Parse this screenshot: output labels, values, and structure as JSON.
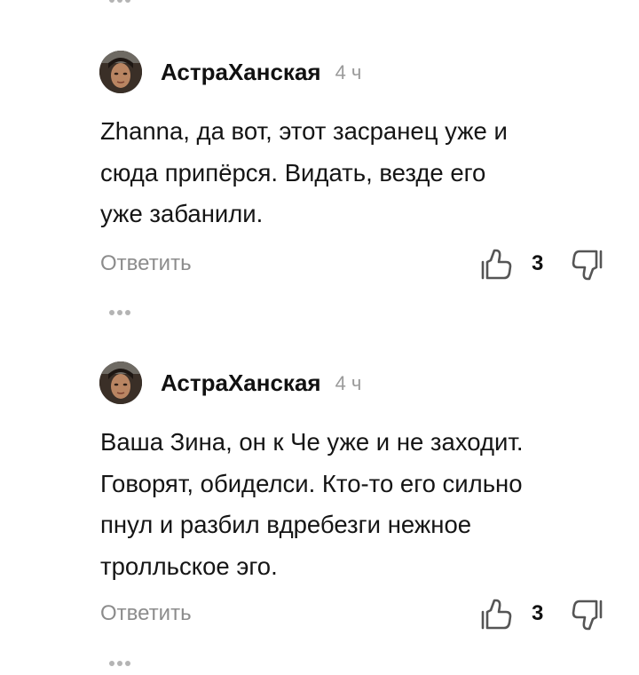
{
  "comments": [
    {
      "author": "АстраХанская",
      "time": "4 ч",
      "lines": [
        "Zhanna, да вот, этот засранец уже и",
        "сюда припёрся. Видать, везде его",
        "уже забанили."
      ],
      "reply_label": "Ответить",
      "likes": "3"
    },
    {
      "author": "АстраХанская",
      "time": "4 ч",
      "lines": [
        "Ваша Зина, он к Че уже и не заходит.",
        "Говорят, обиделси. Кто-то его сильно",
        "пнул и разбил вдребезги нежное",
        "тролльское эго."
      ],
      "reply_label": "Ответить",
      "likes": "3"
    }
  ],
  "colors": {
    "text": "#151515",
    "muted": "#8c8c8c",
    "icon": "#555555",
    "dots": "#b4b4b4"
  },
  "icons": {
    "like": "thumbs-up-icon",
    "dislike": "thumbs-down-icon",
    "more": "more-dots-icon"
  }
}
